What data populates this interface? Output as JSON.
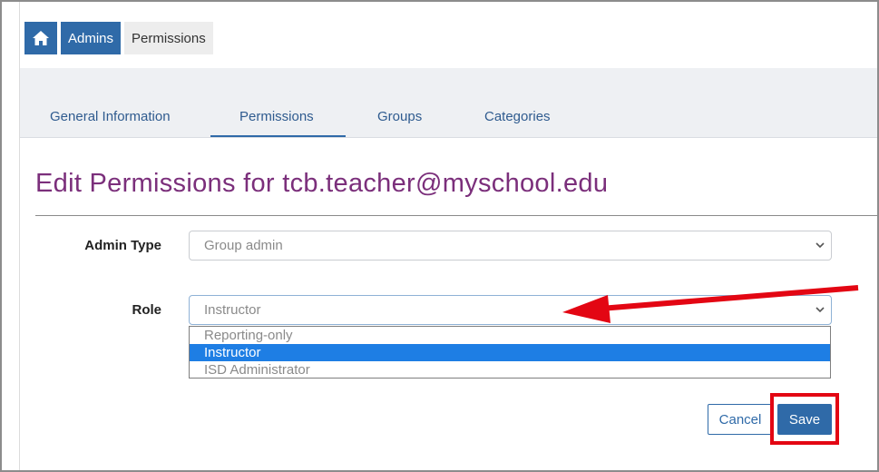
{
  "breadcrumb": {
    "home_icon": "home-icon",
    "items": [
      "Admins",
      "Permissions"
    ]
  },
  "tabs": [
    {
      "label": "General Information",
      "active": false
    },
    {
      "label": "Permissions",
      "active": true
    },
    {
      "label": "Groups",
      "active": false
    },
    {
      "label": "Categories",
      "active": false
    }
  ],
  "page": {
    "title": "Edit Permissions for tcb.teacher@myschool.edu"
  },
  "form": {
    "admin_type": {
      "label": "Admin Type",
      "value": "Group admin"
    },
    "role": {
      "label": "Role",
      "value": "Instructor",
      "options": [
        "Reporting-only",
        "Instructor",
        "ISD Administrator"
      ],
      "selected_index": 1
    }
  },
  "actions": {
    "cancel_label": "Cancel",
    "save_label": "Save"
  },
  "colors": {
    "brand": "#2f6aa8",
    "title": "#7b2f7b",
    "annotation": "#e30613",
    "selected_option": "#1e7ee4"
  }
}
